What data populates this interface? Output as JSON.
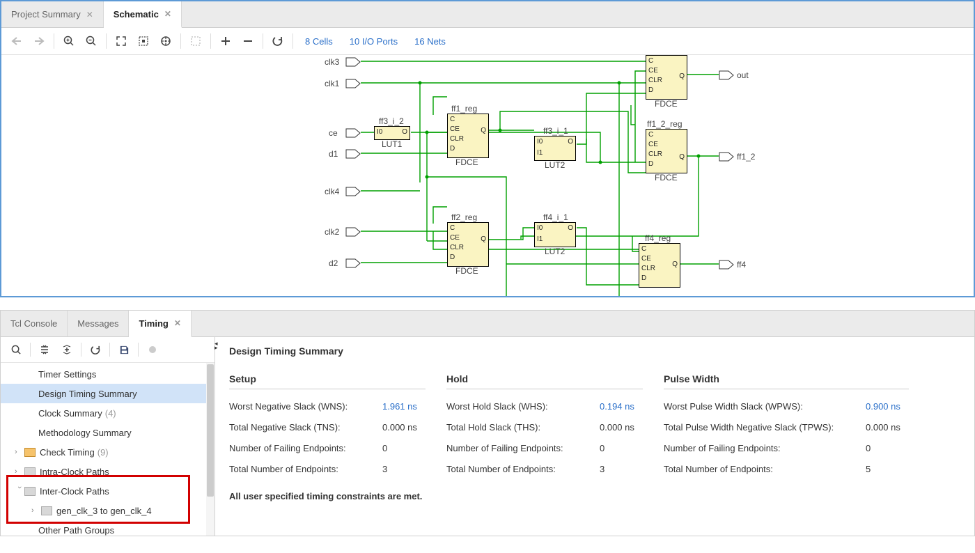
{
  "topTabs": {
    "projectSummary": "Project Summary",
    "schematic": "Schematic"
  },
  "stats": {
    "cells": "8 Cells",
    "ioports": "10 I/O Ports",
    "nets": "16 Nets"
  },
  "schematic": {
    "inputs": [
      "clk3",
      "clk1",
      "ce",
      "d1",
      "clk4",
      "clk2",
      "d2"
    ],
    "outputs": [
      "out",
      "ff1_2",
      "ff4"
    ],
    "blocks": {
      "lut1": {
        "title": "ff3_i_2",
        "type": "LUT1"
      },
      "ff1": {
        "title": "ff1_reg",
        "type": "FDCE"
      },
      "lut2a": {
        "title": "ff3_i_1",
        "type": "LUT2"
      },
      "ff1_2": {
        "title": "ff1_2_reg",
        "type": "FDCE"
      },
      "topfd": {
        "title": "",
        "type": "FDCE"
      },
      "ff2": {
        "title": "ff2_reg",
        "type": "FDCE"
      },
      "lut2b": {
        "title": "ff4_i_1",
        "type": "LUT2"
      },
      "ff4": {
        "title": "ff4_reg",
        "type": "FDCE"
      }
    },
    "pins": {
      "C": "C",
      "CE": "CE",
      "CLR": "CLR",
      "D": "D",
      "Q": "Q",
      "I0": "I0",
      "I1": "I1",
      "O": "O"
    }
  },
  "bottomTabs": {
    "tcl": "Tcl Console",
    "messages": "Messages",
    "timing": "Timing"
  },
  "tree": {
    "timerSettings": "Timer Settings",
    "designTimingSummary": "Design Timing Summary",
    "clockSummary": "Clock Summary",
    "clockSummaryCount": "(4)",
    "methodologySummary": "Methodology Summary",
    "checkTiming": "Check Timing",
    "checkTimingCount": "(9)",
    "intraClockPaths": "Intra-Clock Paths",
    "interClockPaths": "Inter-Clock Paths",
    "genclk34": "gen_clk_3 to gen_clk_4",
    "otherPathGroups": "Other Path Groups"
  },
  "summary": {
    "title": "Design Timing Summary",
    "setup": {
      "heading": "Setup",
      "wns_l": "Worst Negative Slack (WNS):",
      "wns_v": "1.961 ns",
      "tns_l": "Total Negative Slack (TNS):",
      "tns_v": "0.000 ns",
      "nfe_l": "Number of Failing Endpoints:",
      "nfe_v": "0",
      "tne_l": "Total Number of Endpoints:",
      "tne_v": "3"
    },
    "hold": {
      "heading": "Hold",
      "whs_l": "Worst Hold Slack (WHS):",
      "whs_v": "0.194 ns",
      "ths_l": "Total Hold Slack (THS):",
      "ths_v": "0.000 ns",
      "nfe_l": "Number of Failing Endpoints:",
      "nfe_v": "0",
      "tne_l": "Total Number of Endpoints:",
      "tne_v": "3"
    },
    "pw": {
      "heading": "Pulse Width",
      "wpws_l": "Worst Pulse Width Slack (WPWS):",
      "wpws_v": "0.900 ns",
      "tpws_l": "Total Pulse Width Negative Slack (TPWS):",
      "tpws_v": "0.000 ns",
      "nfe_l": "Number of Failing Endpoints:",
      "nfe_v": "0",
      "tne_l": "Total Number of Endpoints:",
      "tne_v": "5"
    },
    "note": "All user specified timing constraints are met."
  }
}
